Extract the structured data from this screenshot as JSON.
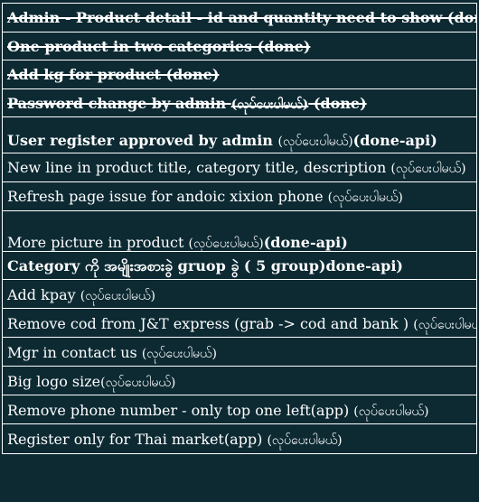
{
  "rows": [
    {
      "main": "Admin - Product detail - id and quantity need to show (done)",
      "status": "",
      "tail": "",
      "bold": true,
      "strike": true
    },
    {
      "main": "One product in two categories (done)",
      "status": "",
      "tail": "",
      "bold": true,
      "strike": true
    },
    {
      "main": "Add kg for product (done)",
      "status": "",
      "tail": "",
      "bold": true,
      "strike": true
    },
    {
      "main": "Password change by admin ",
      "status": "(လုပ်ပေးပါမယ်)",
      "tail": " (done)",
      "bold": true,
      "strike": true
    },
    {
      "main": "User register approved by admin ",
      "status": "(လုပ်ပေးပါမယ်)",
      "tail": "(done-api)",
      "bold": true,
      "strike": false
    },
    {
      "main": "New line in product title, category title, description ",
      "status": "(လုပ်ပေးပါမယ်)",
      "tail": "",
      "bold": false,
      "strike": false
    },
    {
      "main": "Refresh page issue for andoic xixion phone ",
      "status": "(လုပ်ပေးပါမယ်)",
      "tail": "",
      "bold": false,
      "strike": false
    },
    {
      "main": " More picture in product ",
      "status": "(လုပ်ပေးပါမယ်)",
      "tail": "(done-api)",
      "bold": false,
      "strike": false
    },
    {
      "main": "Category ကို အမျိုးအစားခွဲ gruop ခွဲ (  5 group)done-api)",
      "status": "",
      "tail": "",
      "bold": true,
      "strike": false
    },
    {
      "main": "Add kpay ",
      "status": "(လုပ်ပေးပါမယ်)",
      "tail": "",
      "bold": false,
      "strike": false
    },
    {
      "main": "Remove cod from J&T express (grab -> cod and bank ) ",
      "status": "(လုပ်ပေးပါမယ်)",
      "tail": "",
      "bold": false,
      "strike": false
    },
    {
      "main": "Mgr in contact us ",
      "status": "(လုပ်ပေးပါမယ်)",
      "tail": "",
      "bold": false,
      "strike": false
    },
    {
      "main": "Big logo size",
      "status": "(လုပ်ပေးပါမယ်)",
      "tail": "",
      "bold": false,
      "strike": false
    },
    {
      "main": "Remove phone number - only top one left(app) ",
      "status": "(လုပ်ပေးပါမယ်)",
      "tail": "",
      "bold": false,
      "strike": false
    },
    {
      "main": "Register only for Thai market(app) ",
      "status": "(လုပ်ပေးပါမယ်)",
      "tail": "",
      "bold": false,
      "strike": false
    }
  ]
}
